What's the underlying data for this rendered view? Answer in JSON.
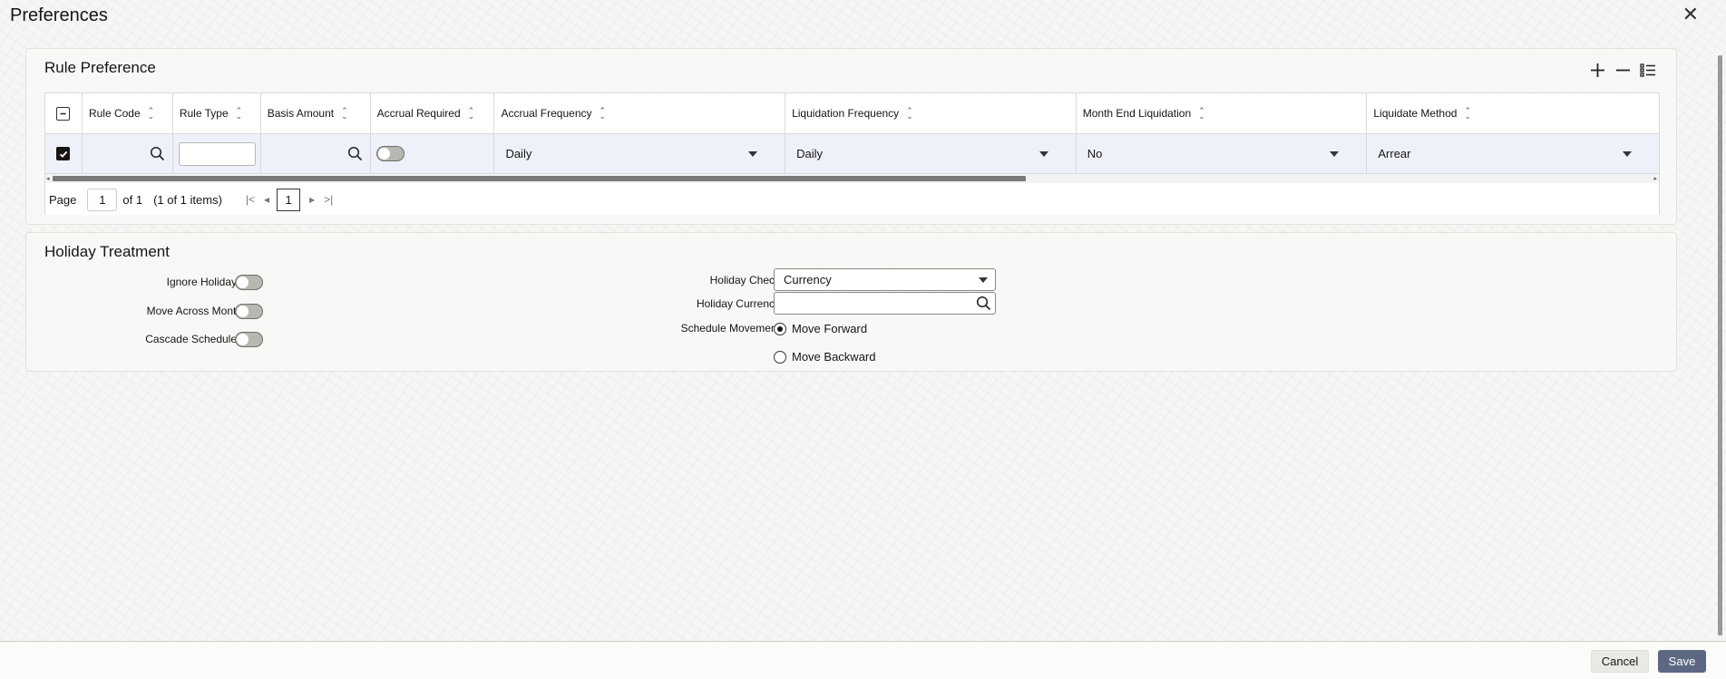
{
  "window": {
    "title": "Preferences"
  },
  "rule_preference": {
    "title": "Rule Preference",
    "columns": [
      "Rule Code",
      "Rule Type",
      "Basis Amount",
      "Accrual Required",
      "Accrual Frequency",
      "Liquidation Frequency",
      "Month End Liquidation",
      "Liquidate Method"
    ],
    "row": {
      "rule_code": "",
      "rule_type": "",
      "basis_amount": "",
      "accrual_required": false,
      "accrual_frequency": "Daily",
      "liquidation_frequency": "Daily",
      "month_end_liquidation": "No",
      "liquidate_method": "Arrear"
    },
    "pager": {
      "page_label": "Page",
      "page_value": "1",
      "of_label": "of 1",
      "items_label": "(1 of 1 items)",
      "current_page": "1"
    }
  },
  "holiday_treatment": {
    "title": "Holiday Treatment",
    "ignore_holidays_label": "Ignore Holidays",
    "move_across_month_label": "Move Across Month",
    "cascade_schedules_label": "Cascade Schedules",
    "holiday_check_label": "Holiday Check",
    "holiday_check_value": "Currency",
    "holiday_currency_label": "Holiday Currency",
    "holiday_currency_value": "",
    "schedule_movement_label": "Schedule Movement",
    "move_forward_label": "Move Forward",
    "move_backward_label": "Move Backward",
    "schedule_movement_selected": "Move Forward"
  },
  "footer": {
    "cancel_label": "Cancel",
    "save_label": "Save"
  }
}
